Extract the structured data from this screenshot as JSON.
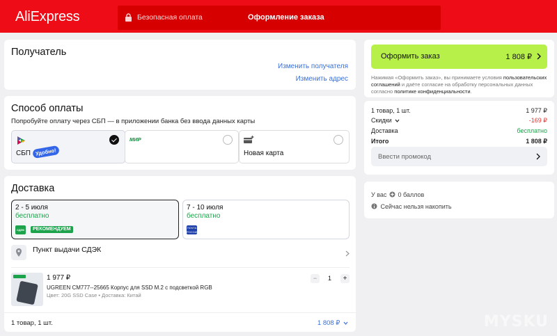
{
  "header": {
    "logo": "AliExpress",
    "secure_label": "Безопасная оплата",
    "title": "Оформление заказа"
  },
  "recipient": {
    "title": "Получатель",
    "change_recipient": "Изменить получателя",
    "change_address": "Изменить адрес"
  },
  "payment": {
    "title": "Способ оплаты",
    "subtitle": "Попробуйте оплату через СБП — в приложении банка без ввода данных карты",
    "options": [
      {
        "label": "СБП",
        "badge": "Удобно!",
        "selected": true,
        "icon": "sbp-icon"
      },
      {
        "label": "",
        "brand": "МИР",
        "selected": false,
        "icon": "mir-icon"
      },
      {
        "label": "Новая карта",
        "selected": false,
        "icon": "new-card-icon"
      }
    ]
  },
  "delivery": {
    "title": "Доставка",
    "options": [
      {
        "date": "2 - 5 июля",
        "price": "бесплатно",
        "carrier": "СДЭК",
        "badge": "РЕКОМЕНДУЕМ",
        "selected": true
      },
      {
        "date": "7 - 10 июля",
        "price": "бесплатно",
        "carrier": "ПОЧТА РОССИИ",
        "selected": false
      }
    ],
    "pickup_label": "Пункт выдачи СДЭК"
  },
  "product": {
    "price": "1 977 ₽",
    "name": "UGREEN CM777--25665 Корпус для SSD M.2 с подсветкой RGB",
    "meta": "Цвет: 20G SSD Case • Доставка: Китай",
    "qty": "1",
    "minus": "−",
    "plus": "+"
  },
  "footer": {
    "count": "1 товар, 1 шт.",
    "total": "1 808 ₽"
  },
  "order": {
    "button_label": "Оформить заказ",
    "button_price": "1 808 ₽",
    "legal_pre": "Нажимая «Оформить заказ», вы принимаете условия ",
    "legal_link1": "пользовательских соглашений",
    "legal_mid": " и даёте согласие на обработку персональных данных согласно ",
    "legal_link2": "политике конфиденциальности",
    "legal_end": "."
  },
  "summary": {
    "items_label": "1 товар, 1 шт.",
    "items_value": "1 977 ₽",
    "discount_label": "Скидки",
    "discount_value": "-169 ₽",
    "shipping_label": "Доставка",
    "shipping_value": "бесплатно",
    "total_label": "Итого",
    "total_value": "1 808 ₽",
    "promo_placeholder": "Ввести промокод"
  },
  "bonus": {
    "balance_pre": "У вас",
    "balance_post": "0 баллов",
    "note": "Сейчас нельзя накопить"
  },
  "watermark": "MYSKU",
  "colors": {
    "brand_red": "#ee0c16",
    "accent_green": "#b8f04a",
    "link_blue": "#3a6fd8",
    "free_green": "#1ba34a",
    "discount_red": "#e8312f"
  }
}
